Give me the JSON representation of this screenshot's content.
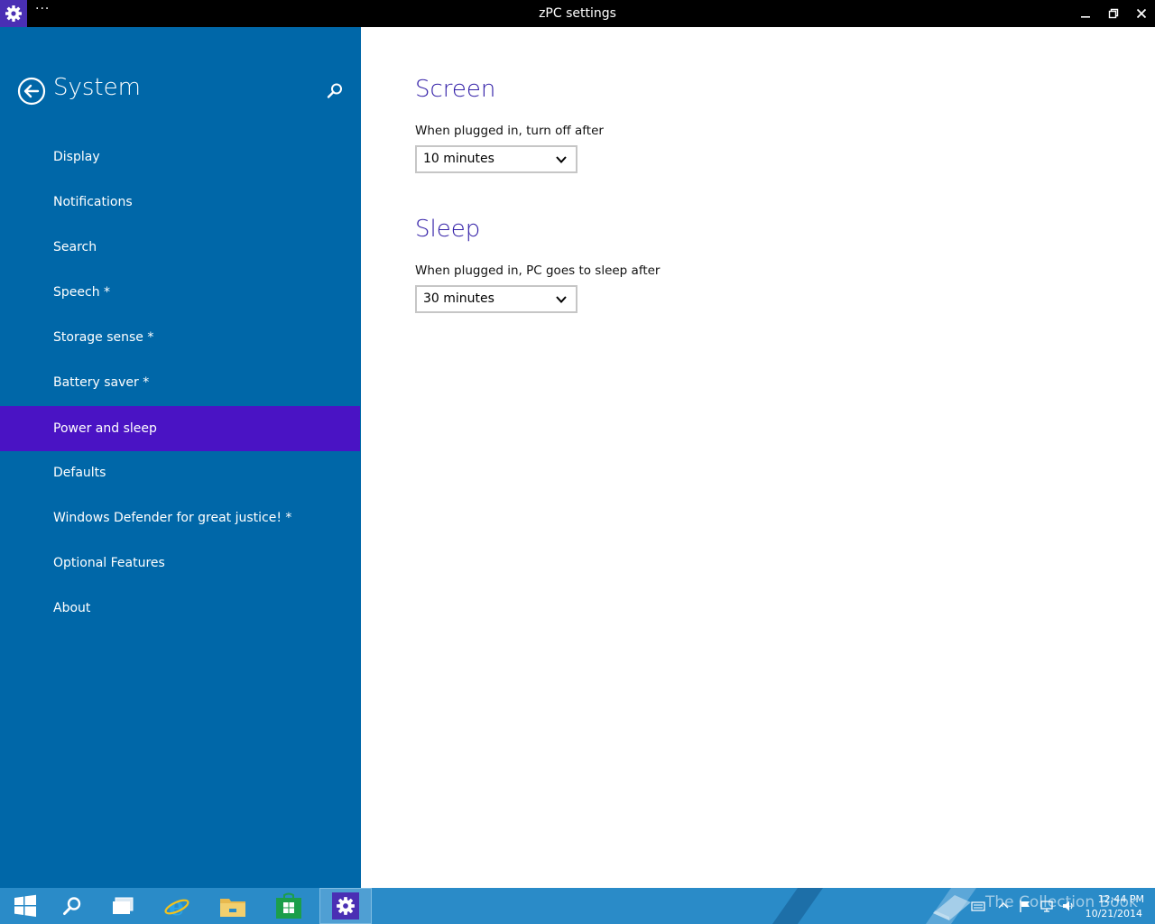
{
  "window": {
    "title": "zPC settings",
    "menu_label": "···"
  },
  "sidebar": {
    "title": "System",
    "items": [
      {
        "label": "Display"
      },
      {
        "label": "Notifications"
      },
      {
        "label": "Search"
      },
      {
        "label": "Speech *"
      },
      {
        "label": "Storage sense *"
      },
      {
        "label": "Battery saver *"
      },
      {
        "label": "Power and sleep",
        "selected": true
      },
      {
        "label": "Defaults"
      },
      {
        "label": "Windows Defender for great justice! *"
      },
      {
        "label": "Optional Features"
      },
      {
        "label": "About"
      }
    ]
  },
  "main": {
    "screen": {
      "title": "Screen",
      "label": "When plugged in, turn off after",
      "value": "10 minutes"
    },
    "sleep": {
      "title": "Sleep",
      "label": "When plugged in, PC goes to sleep after",
      "value": "30 minutes"
    }
  },
  "taskbar": {
    "buttons": [
      {
        "icon": "windows-start-icon"
      },
      {
        "icon": "search-icon"
      },
      {
        "icon": "task-view-icon"
      },
      {
        "icon": "internet-explorer-icon"
      },
      {
        "icon": "file-explorer-icon"
      },
      {
        "icon": "store-icon"
      },
      {
        "icon": "settings-gear-icon",
        "active": true
      }
    ],
    "watermark": "The Collection Book",
    "clock_time": "12:44 PM",
    "clock_date": "10/21/2014"
  },
  "colors": {
    "sidebar_bg": "#0067a8",
    "selected_bg": "#4a13c4",
    "accent_heading": "#3421a8",
    "taskbar_bg": "#2a8bc8",
    "titlebar_bg": "#000000"
  }
}
